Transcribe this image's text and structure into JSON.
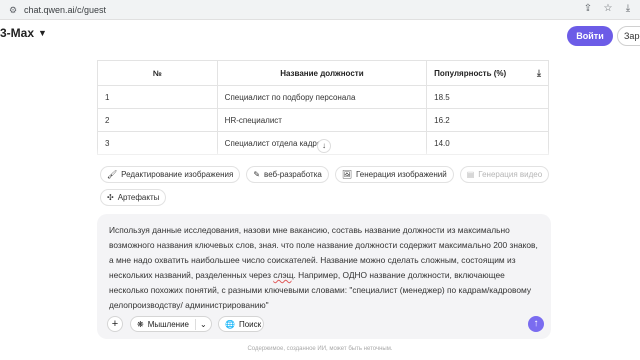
{
  "browser": {
    "url": "chat.qwen.ai/c/guest"
  },
  "header": {
    "model_label": "3-Max",
    "login_label": "Войти",
    "register_label": "Зарег"
  },
  "table": {
    "headers": [
      "№",
      "Название должности",
      "Популярность (%)"
    ],
    "rows": [
      [
        "1",
        "Специалист по подбору персонала",
        "18.5"
      ],
      [
        "2",
        "HR-специалист",
        "16.2"
      ],
      [
        "3",
        "Специалист отдела кадров",
        "14.0"
      ]
    ]
  },
  "chips": [
    {
      "label": "Редактирование изображения",
      "icon": "paint-icon"
    },
    {
      "label": "веб-разработка",
      "icon": "code-icon"
    },
    {
      "label": "Генерация изображений",
      "icon": "image-icon"
    },
    {
      "label": "Генерация видео",
      "icon": "video-icon",
      "disabled": true
    },
    {
      "label": "Артефакты",
      "icon": "artifact-icon"
    }
  ],
  "composer": {
    "text_before": "Используя данные исследования, назови мне вакансию, составь название должности из максимально возможного названия ключевых слов, зная. что поле название должности содержит максимально 200 знаков, а мне надо охватить наибольшее число соискателей. Название можно сделать сложным, состоящим из нескольких названий, разделенных через ",
    "text_underlined": "слэщ",
    "text_after": ". Например, ОДНО название должности, включающее несколько похожих понятий, с разными ключевыми словами: \"специалист (менеджер) по кадрам/кадровому делопроизводству/ администрированию\"",
    "thinking_label": "Мышление",
    "search_label": "Поиск"
  },
  "disclaimer": "Содержимое, созданное ИИ, может быть неточным.",
  "colors": {
    "accent": "#6c5ce7",
    "send": "#7a6cf0",
    "composer_bg": "#f4f4f6"
  }
}
